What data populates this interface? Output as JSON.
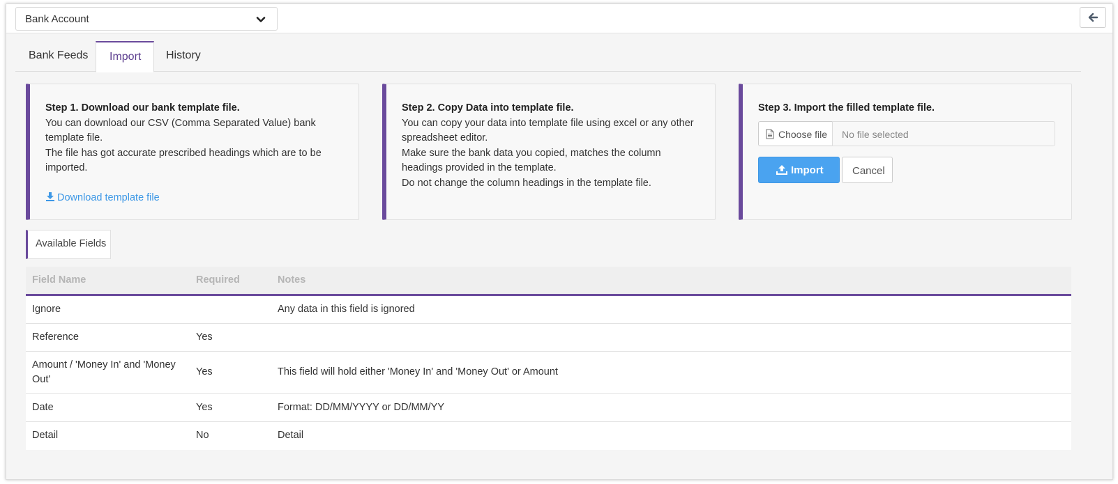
{
  "header": {
    "account_select_value": "Bank Account",
    "chevron_icon": "chevron-down-icon",
    "back_icon": "arrow-left-icon"
  },
  "tabs": [
    {
      "label": "Bank Feeds",
      "active": false
    },
    {
      "label": "Import",
      "active": true
    },
    {
      "label": "History",
      "active": false
    }
  ],
  "steps": {
    "step1": {
      "title": "Step 1. Download our bank template file.",
      "line1": "You can download our CSV (Comma Separated Value) bank template file.",
      "line2": "The file has got accurate prescribed headings which are to be imported.",
      "link_label": "Download template file",
      "link_icon": "download-icon"
    },
    "step2": {
      "title": "Step 2. Copy Data into template file.",
      "line1": "You can copy your data into template file using excel or any other spreadsheet editor.",
      "line2": "Make sure the bank data you copied, matches the column headings provided in the template.",
      "line3": "Do not change the column headings in the template file."
    },
    "step3": {
      "title": "Step 3. Import the filled template file.",
      "choose_file_label": "Choose file",
      "file_name_placeholder": "No file selected",
      "import_label": "Import",
      "cancel_label": "Cancel",
      "import_icon": "upload-icon"
    }
  },
  "available_fields": {
    "label": "Available Fields",
    "headers": {
      "field_name": "Field Name",
      "required": "Required",
      "notes": "Notes"
    },
    "rows": [
      {
        "field": "Ignore",
        "required": "",
        "notes": "Any data in this field is ignored"
      },
      {
        "field": "Reference",
        "required": "Yes",
        "notes": ""
      },
      {
        "field": "Amount / 'Money In' and 'Money Out'",
        "required": "Yes",
        "notes": "This field will hold either 'Money In' and 'Money Out' or Amount"
      },
      {
        "field": "Date",
        "required": "Yes",
        "notes": "Format: DD/MM/YYYY or DD/MM/YY"
      },
      {
        "field": "Detail",
        "required": "No",
        "notes": "Detail"
      }
    ]
  },
  "colors": {
    "accent_purple": "#6a4a9c",
    "primary_blue": "#4aa3f0",
    "link_blue": "#3e98e6"
  }
}
